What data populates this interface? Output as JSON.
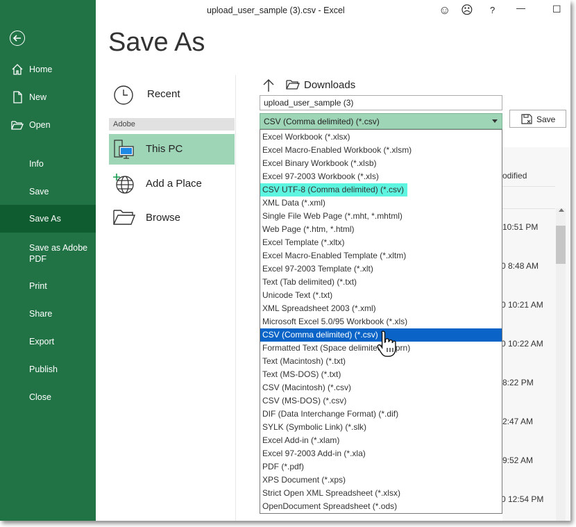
{
  "window": {
    "title": "upload_user_sample (3).csv  -  Excel",
    "controls": [
      "☺",
      "☹",
      "?",
      "—",
      "☐"
    ]
  },
  "sidebar": {
    "items": [
      {
        "label": "Home",
        "icon": "home-icon"
      },
      {
        "label": "New",
        "icon": "new-document-icon"
      },
      {
        "label": "Open",
        "icon": "open-folder-icon"
      },
      {
        "label": "Info"
      },
      {
        "label": "Save"
      },
      {
        "label": "Save As",
        "active": true
      },
      {
        "label": "Save as Adobe PDF",
        "line1": "Save as Adobe",
        "line2": "PDF"
      },
      {
        "label": "Print"
      },
      {
        "label": "Share"
      },
      {
        "label": "Export"
      },
      {
        "label": "Publish"
      },
      {
        "label": "Close"
      }
    ]
  },
  "page": {
    "heading": "Save As"
  },
  "locations": {
    "recent": "Recent",
    "section": "Adobe",
    "this_pc": "This PC",
    "add_place": "Add a Place",
    "browse": "Browse"
  },
  "browser": {
    "folder": "Downloads",
    "filename": "upload_user_sample (3)",
    "filetype": "CSV (Comma delimited) (*.csv)",
    "save_label": "Save",
    "column_header": "odified",
    "times": [
      "10:51 PM",
      "0 8:48 AM",
      "0 10:21 AM",
      "0 10:22 AM",
      "8:22 PM",
      "2:47 AM",
      "9:52 AM",
      "0 12:54 PM"
    ]
  },
  "file_types": [
    "Excel Workbook (*.xlsx)",
    "Excel Macro-Enabled Workbook (*.xlsm)",
    "Excel Binary Workbook (*.xlsb)",
    "Excel 97-2003 Workbook (*.xls)",
    "CSV UTF-8 (Comma delimited) (*.csv)",
    "XML Data (*.xml)",
    "Single File Web Page (*.mht, *.mhtml)",
    "Web Page (*.htm, *.html)",
    "Excel Template (*.xltx)",
    "Excel Macro-Enabled Template (*.xltm)",
    "Excel 97-2003 Template (*.xlt)",
    "Text (Tab delimited) (*.txt)",
    "Unicode Text (*.txt)",
    "XML Spreadsheet 2003 (*.xml)",
    "Microsoft Excel 5.0/95 Workbook (*.xls)",
    "CSV (Comma delimited) (*.csv)",
    "Formatted Text (Space delimited) (*.prn)",
    "Text (Macintosh) (*.txt)",
    "Text (MS-DOS) (*.txt)",
    "CSV (Macintosh) (*.csv)",
    "CSV (MS-DOS) (*.csv)",
    "DIF (Data Interchange Format) (*.dif)",
    "SYLK (Symbolic Link) (*.slk)",
    "Excel Add-in (*.xlam)",
    "Excel 97-2003 Add-in (*.xla)",
    "PDF (*.pdf)",
    "XPS Document (*.xps)",
    "Strict Open XML Spreadsheet (*.xlsx)",
    "OpenDocument Spreadsheet (*.ods)"
  ],
  "highlighted_index": 4,
  "selected_index": 15,
  "colors": {
    "excel_green": "#217346",
    "active_nav": "#0e5c2f",
    "selection_green": "#9fd5b7",
    "highlight_cyan": "#5ef5e0",
    "list_selected_blue": "#0a64c8"
  }
}
